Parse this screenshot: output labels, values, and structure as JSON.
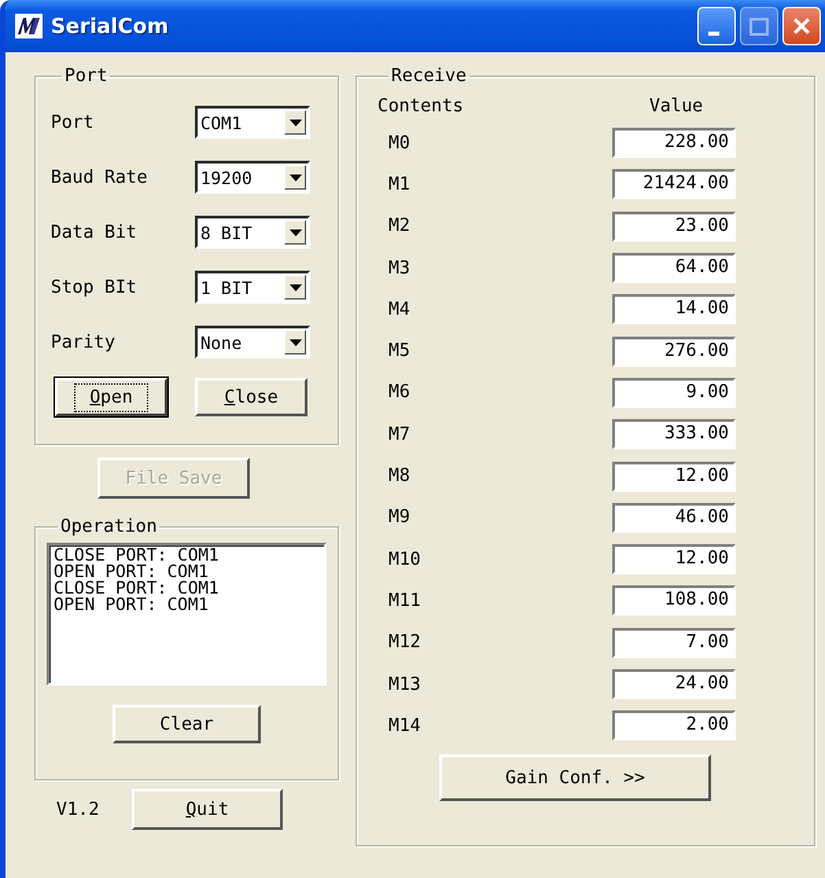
{
  "window": {
    "title": "SerialCom"
  },
  "port": {
    "title": "Port",
    "settings": [
      {
        "label": "Port",
        "value": "COM1"
      },
      {
        "label": "Baud Rate",
        "value": "19200"
      },
      {
        "label": "Data Bit",
        "value": "8 BIT"
      },
      {
        "label": "Stop BIt",
        "value": "1 BIT"
      },
      {
        "label": "Parity",
        "value": "None"
      }
    ],
    "buttons": [
      {
        "label": "Open",
        "default": true,
        "mnemonic": true
      },
      {
        "label": "Close",
        "default": false,
        "mnemonic": true
      }
    ]
  },
  "file_save": {
    "label": "File Save",
    "disabled": true
  },
  "operation": {
    "title": "Operation",
    "log": [
      "CLOSE PORT: COM1",
      "OPEN PORT: COM1",
      "CLOSE PORT: COM1",
      "OPEN PORT: COM1"
    ],
    "clear": {
      "label": "Clear",
      "disabled": false
    }
  },
  "version": "V1.2",
  "quit": {
    "label": "Quit",
    "mnemonic": true
  },
  "receive": {
    "title": "Receive",
    "columns": [
      "Contents",
      "Value"
    ],
    "rows": [
      {
        "name": "M0",
        "value": "228.00"
      },
      {
        "name": "M1",
        "value": "21424.00"
      },
      {
        "name": "M2",
        "value": "23.00"
      },
      {
        "name": "M3",
        "value": "64.00"
      },
      {
        "name": "M4",
        "value": "14.00"
      },
      {
        "name": "M5",
        "value": "276.00"
      },
      {
        "name": "M6",
        "value": "9.00"
      },
      {
        "name": "M7",
        "value": "333.00"
      },
      {
        "name": "M8",
        "value": "12.00"
      },
      {
        "name": "M9",
        "value": "46.00"
      },
      {
        "name": "M10",
        "value": "12.00"
      },
      {
        "name": "M11",
        "value": "108.00"
      },
      {
        "name": "M12",
        "value": "7.00"
      },
      {
        "name": "M13",
        "value": "24.00"
      },
      {
        "name": "M14",
        "value": "2.00"
      }
    ],
    "gain": {
      "label": "Gain Conf. >>"
    }
  }
}
